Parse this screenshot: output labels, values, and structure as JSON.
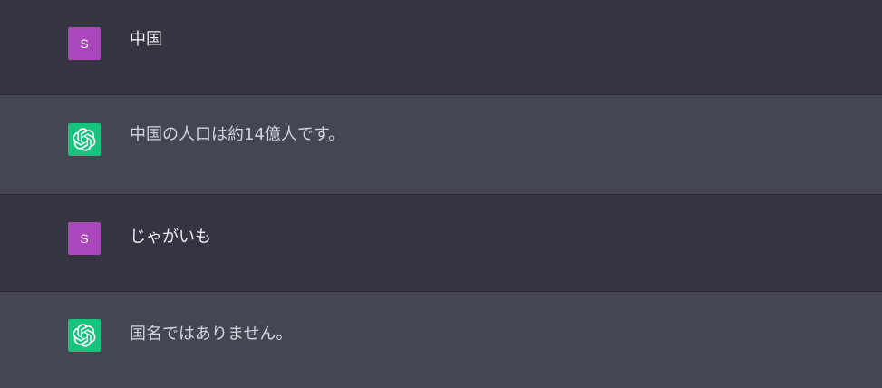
{
  "colors": {
    "user_bg": "#343541",
    "assistant_bg": "#444654",
    "user_avatar": "#ab47bc",
    "assistant_avatar": "#19c37d"
  },
  "messages": [
    {
      "role": "user",
      "avatar_letter": "S",
      "text": "中国"
    },
    {
      "role": "assistant",
      "avatar_icon": "openai-logo-icon",
      "text": "中国の人口は約14億人です。"
    },
    {
      "role": "user",
      "avatar_letter": "S",
      "text": "じゃがいも"
    },
    {
      "role": "assistant",
      "avatar_icon": "openai-logo-icon",
      "text": "国名ではありません。"
    }
  ]
}
